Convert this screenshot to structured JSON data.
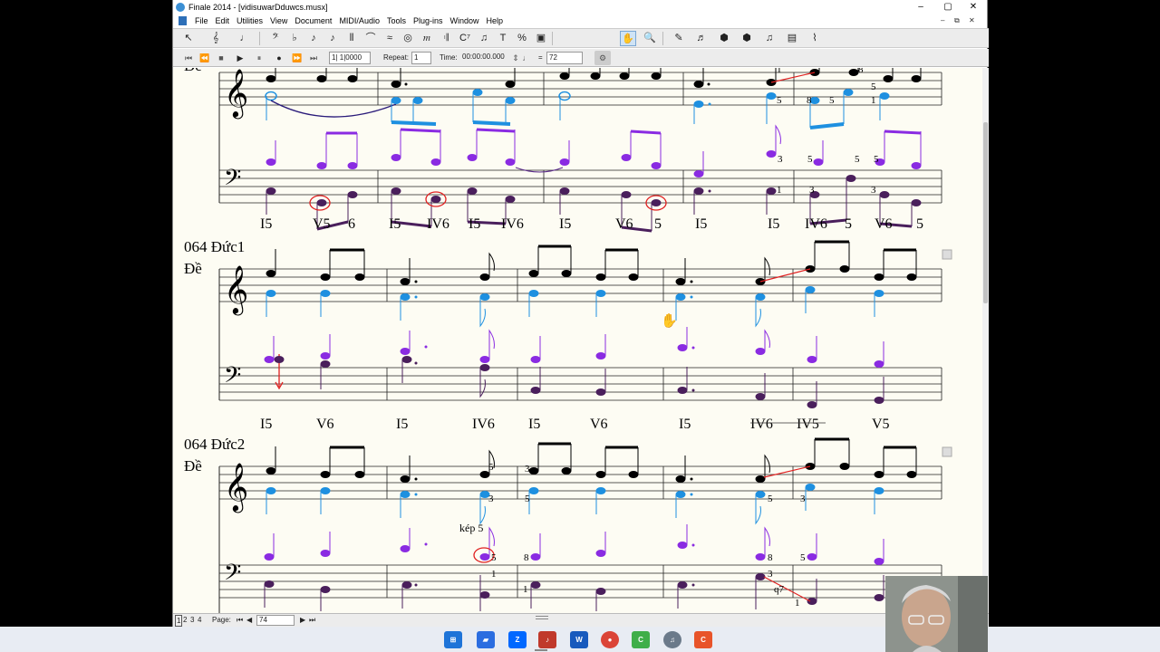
{
  "window": {
    "title": "Finale 2014 - [vidisuwarDduwcs.musx]"
  },
  "menu": [
    "File",
    "Edit",
    "Utilities",
    "View",
    "Document",
    "MIDI/Audio",
    "Tools",
    "Plug-ins",
    "Window",
    "Help"
  ],
  "toolbar": {
    "tools": [
      "selection-tool",
      "staff-tool",
      "simple-entry-tool",
      "clef-tool",
      "key-signature-tool",
      "time-signature-tool",
      "note-entry-tool",
      "tuplet-tool",
      "smart-shape-tool",
      "articulation-tool",
      "expression-tool",
      "repeat-tool",
      "chord-tool",
      "lyrics-tool",
      "text-tool",
      "resize-tool",
      "graphics-tool",
      "hand-grabber-tool",
      "zoom-tool",
      "special-tools",
      "mirror-tool",
      "note-mover-tool",
      "percussion-tool",
      "mass-edit-tool",
      "page-layout-tool",
      "measure-tool"
    ]
  },
  "playback": {
    "measure_value": "1| 1|0000",
    "repeat_label": "Repeat:",
    "repeat_value": "1",
    "time_label": "Time:",
    "time_value": "00:00:00.000",
    "tempo_eq": "=",
    "tempo_value": "72"
  },
  "status": {
    "pages": [
      "1",
      "2",
      "3",
      "4"
    ],
    "page_label": "Page:",
    "page_value": "74"
  },
  "score": {
    "system1": {
      "chords": [
        "I5",
        "V5",
        "6",
        "I5",
        "IV6",
        "I5",
        "IV6",
        "I5",
        "V6",
        "5",
        "I5",
        "I5",
        "IV6",
        "5",
        "V6",
        "5"
      ],
      "treble_figures": [
        "1",
        "8",
        "5",
        "8",
        "5",
        "1",
        "5"
      ],
      "bass_figures": [
        "3",
        "5",
        "5",
        "5",
        "1",
        "3",
        "3"
      ]
    },
    "system2": {
      "label_line1": "064 Đức1",
      "label_line2": "Đề",
      "chords": [
        "I5",
        "V6",
        "I5",
        "IV6",
        "I5",
        "V6",
        "I5",
        "IV6",
        "IV5",
        "V5"
      ]
    },
    "system3": {
      "label_line1": "064 Đức2",
      "label_line2": "Đề",
      "annotation": "kép 5",
      "treble_figures": [
        "5",
        "3",
        "3",
        "5",
        "5",
        "3"
      ],
      "bass_figures": [
        "5",
        "8",
        "1",
        "1",
        "8",
        "5",
        "3",
        "q7",
        "1"
      ]
    },
    "colors": {
      "melody": "#000000",
      "alto": "#1e90e0",
      "tenor": "#8a2be2",
      "bass": "#4a1f5c",
      "highlight": "#e02020"
    }
  },
  "taskbar": {
    "icons": [
      "windows-start-icon",
      "file-explorer-icon",
      "zalo-icon",
      "finale-icon",
      "word-icon",
      "chrome-icon",
      "camtasia-icon",
      "finale-active-icon",
      "recorder-icon"
    ]
  }
}
